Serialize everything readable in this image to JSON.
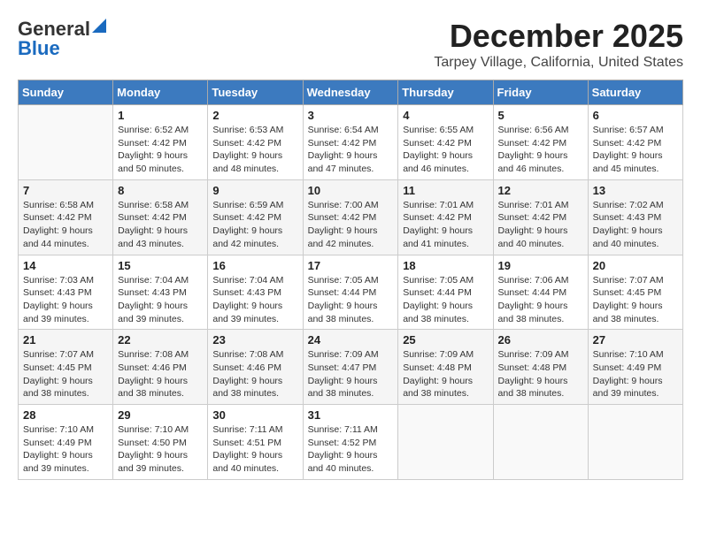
{
  "header": {
    "logo_line1_general": "General",
    "logo_line2_blue": "Blue",
    "month_title": "December 2025",
    "location": "Tarpey Village, California, United States"
  },
  "days_of_week": [
    "Sunday",
    "Monday",
    "Tuesday",
    "Wednesday",
    "Thursday",
    "Friday",
    "Saturday"
  ],
  "weeks": [
    [
      {
        "day": "",
        "sunrise": "",
        "sunset": "",
        "daylight": ""
      },
      {
        "day": "1",
        "sunrise": "Sunrise: 6:52 AM",
        "sunset": "Sunset: 4:42 PM",
        "daylight": "Daylight: 9 hours and 50 minutes."
      },
      {
        "day": "2",
        "sunrise": "Sunrise: 6:53 AM",
        "sunset": "Sunset: 4:42 PM",
        "daylight": "Daylight: 9 hours and 48 minutes."
      },
      {
        "day": "3",
        "sunrise": "Sunrise: 6:54 AM",
        "sunset": "Sunset: 4:42 PM",
        "daylight": "Daylight: 9 hours and 47 minutes."
      },
      {
        "day": "4",
        "sunrise": "Sunrise: 6:55 AM",
        "sunset": "Sunset: 4:42 PM",
        "daylight": "Daylight: 9 hours and 46 minutes."
      },
      {
        "day": "5",
        "sunrise": "Sunrise: 6:56 AM",
        "sunset": "Sunset: 4:42 PM",
        "daylight": "Daylight: 9 hours and 46 minutes."
      },
      {
        "day": "6",
        "sunrise": "Sunrise: 6:57 AM",
        "sunset": "Sunset: 4:42 PM",
        "daylight": "Daylight: 9 hours and 45 minutes."
      }
    ],
    [
      {
        "day": "7",
        "sunrise": "Sunrise: 6:58 AM",
        "sunset": "Sunset: 4:42 PM",
        "daylight": "Daylight: 9 hours and 44 minutes."
      },
      {
        "day": "8",
        "sunrise": "Sunrise: 6:58 AM",
        "sunset": "Sunset: 4:42 PM",
        "daylight": "Daylight: 9 hours and 43 minutes."
      },
      {
        "day": "9",
        "sunrise": "Sunrise: 6:59 AM",
        "sunset": "Sunset: 4:42 PM",
        "daylight": "Daylight: 9 hours and 42 minutes."
      },
      {
        "day": "10",
        "sunrise": "Sunrise: 7:00 AM",
        "sunset": "Sunset: 4:42 PM",
        "daylight": "Daylight: 9 hours and 42 minutes."
      },
      {
        "day": "11",
        "sunrise": "Sunrise: 7:01 AM",
        "sunset": "Sunset: 4:42 PM",
        "daylight": "Daylight: 9 hours and 41 minutes."
      },
      {
        "day": "12",
        "sunrise": "Sunrise: 7:01 AM",
        "sunset": "Sunset: 4:42 PM",
        "daylight": "Daylight: 9 hours and 40 minutes."
      },
      {
        "day": "13",
        "sunrise": "Sunrise: 7:02 AM",
        "sunset": "Sunset: 4:43 PM",
        "daylight": "Daylight: 9 hours and 40 minutes."
      }
    ],
    [
      {
        "day": "14",
        "sunrise": "Sunrise: 7:03 AM",
        "sunset": "Sunset: 4:43 PM",
        "daylight": "Daylight: 9 hours and 39 minutes."
      },
      {
        "day": "15",
        "sunrise": "Sunrise: 7:04 AM",
        "sunset": "Sunset: 4:43 PM",
        "daylight": "Daylight: 9 hours and 39 minutes."
      },
      {
        "day": "16",
        "sunrise": "Sunrise: 7:04 AM",
        "sunset": "Sunset: 4:43 PM",
        "daylight": "Daylight: 9 hours and 39 minutes."
      },
      {
        "day": "17",
        "sunrise": "Sunrise: 7:05 AM",
        "sunset": "Sunset: 4:44 PM",
        "daylight": "Daylight: 9 hours and 38 minutes."
      },
      {
        "day": "18",
        "sunrise": "Sunrise: 7:05 AM",
        "sunset": "Sunset: 4:44 PM",
        "daylight": "Daylight: 9 hours and 38 minutes."
      },
      {
        "day": "19",
        "sunrise": "Sunrise: 7:06 AM",
        "sunset": "Sunset: 4:44 PM",
        "daylight": "Daylight: 9 hours and 38 minutes."
      },
      {
        "day": "20",
        "sunrise": "Sunrise: 7:07 AM",
        "sunset": "Sunset: 4:45 PM",
        "daylight": "Daylight: 9 hours and 38 minutes."
      }
    ],
    [
      {
        "day": "21",
        "sunrise": "Sunrise: 7:07 AM",
        "sunset": "Sunset: 4:45 PM",
        "daylight": "Daylight: 9 hours and 38 minutes."
      },
      {
        "day": "22",
        "sunrise": "Sunrise: 7:08 AM",
        "sunset": "Sunset: 4:46 PM",
        "daylight": "Daylight: 9 hours and 38 minutes."
      },
      {
        "day": "23",
        "sunrise": "Sunrise: 7:08 AM",
        "sunset": "Sunset: 4:46 PM",
        "daylight": "Daylight: 9 hours and 38 minutes."
      },
      {
        "day": "24",
        "sunrise": "Sunrise: 7:09 AM",
        "sunset": "Sunset: 4:47 PM",
        "daylight": "Daylight: 9 hours and 38 minutes."
      },
      {
        "day": "25",
        "sunrise": "Sunrise: 7:09 AM",
        "sunset": "Sunset: 4:48 PM",
        "daylight": "Daylight: 9 hours and 38 minutes."
      },
      {
        "day": "26",
        "sunrise": "Sunrise: 7:09 AM",
        "sunset": "Sunset: 4:48 PM",
        "daylight": "Daylight: 9 hours and 38 minutes."
      },
      {
        "day": "27",
        "sunrise": "Sunrise: 7:10 AM",
        "sunset": "Sunset: 4:49 PM",
        "daylight": "Daylight: 9 hours and 39 minutes."
      }
    ],
    [
      {
        "day": "28",
        "sunrise": "Sunrise: 7:10 AM",
        "sunset": "Sunset: 4:49 PM",
        "daylight": "Daylight: 9 hours and 39 minutes."
      },
      {
        "day": "29",
        "sunrise": "Sunrise: 7:10 AM",
        "sunset": "Sunset: 4:50 PM",
        "daylight": "Daylight: 9 hours and 39 minutes."
      },
      {
        "day": "30",
        "sunrise": "Sunrise: 7:11 AM",
        "sunset": "Sunset: 4:51 PM",
        "daylight": "Daylight: 9 hours and 40 minutes."
      },
      {
        "day": "31",
        "sunrise": "Sunrise: 7:11 AM",
        "sunset": "Sunset: 4:52 PM",
        "daylight": "Daylight: 9 hours and 40 minutes."
      },
      {
        "day": "",
        "sunrise": "",
        "sunset": "",
        "daylight": ""
      },
      {
        "day": "",
        "sunrise": "",
        "sunset": "",
        "daylight": ""
      },
      {
        "day": "",
        "sunrise": "",
        "sunset": "",
        "daylight": ""
      }
    ]
  ]
}
